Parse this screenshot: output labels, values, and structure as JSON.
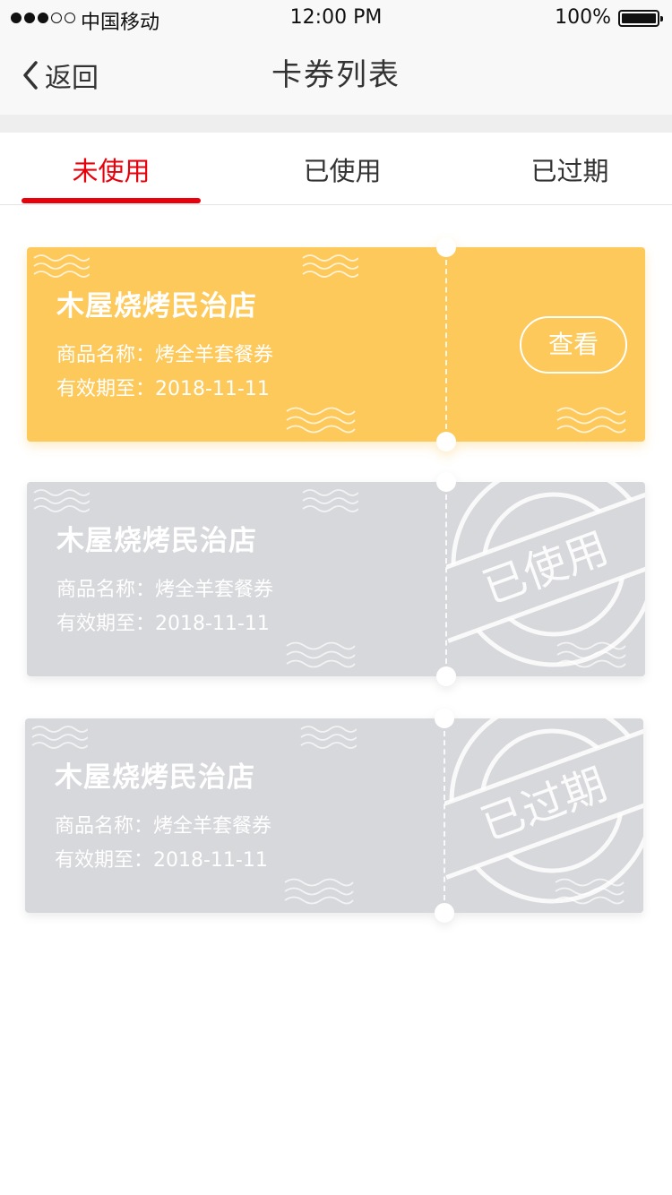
{
  "status_bar": {
    "carrier": "中国移动",
    "time": "12:00 PM",
    "battery": "100%",
    "signal_icon": "signal-dots-icon",
    "battery_icon": "battery-full-icon"
  },
  "nav": {
    "back_label": "返回",
    "back_icon": "chevron-left-icon",
    "title": "卡券列表"
  },
  "tabs": [
    {
      "label": "未使用",
      "active": true
    },
    {
      "label": "已使用",
      "active": false
    },
    {
      "label": "已过期",
      "active": false
    }
  ],
  "colors": {
    "accent": "#e8000b",
    "coupon_active": "#fdc95b",
    "coupon_inactive": "#d7d8db"
  },
  "coupons": [
    {
      "store": "木屋烧烤民治店",
      "product_line": "商品名称：烤全羊套餐券",
      "expiry_line": "有效期至：2018-11-11",
      "status": "unused",
      "action_label": "查看"
    },
    {
      "store": "木屋烧烤民治店",
      "product_line": "商品名称：烤全羊套餐券",
      "expiry_line": "有效期至：2018-11-11",
      "status": "used",
      "stamp_label": "已使用"
    },
    {
      "store": "木屋烧烤民治店",
      "product_line": "商品名称：烤全羊套餐券",
      "expiry_line": "有效期至：2018-11-11",
      "status": "expired",
      "stamp_label": "已过期"
    }
  ]
}
